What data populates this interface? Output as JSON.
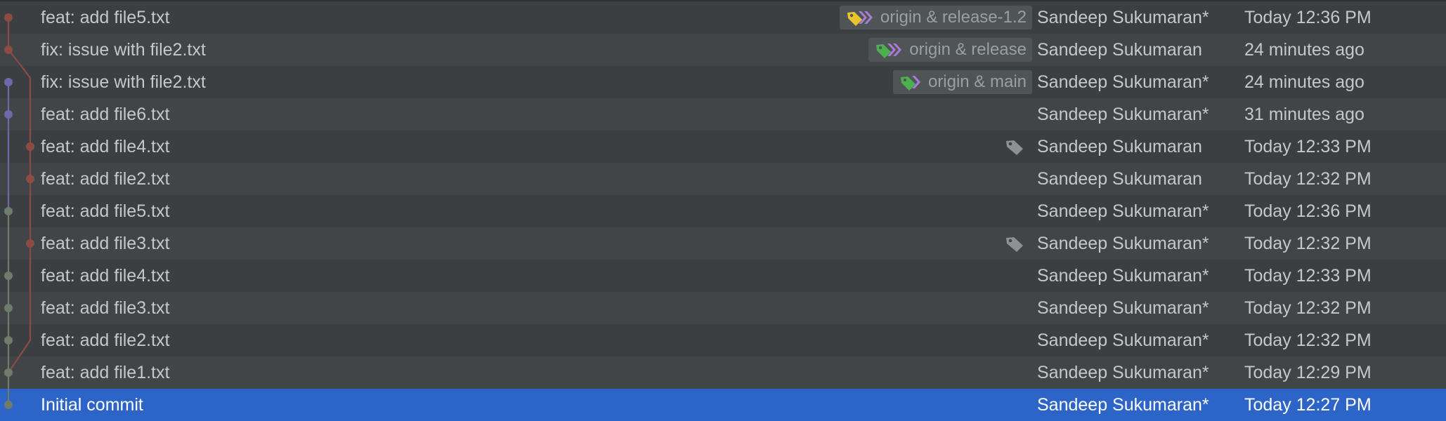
{
  "colors": {
    "background": "#3c3f41",
    "row_alt": "#414547",
    "selected": "#2d64c8",
    "branch_red": "#8c4c44",
    "branch_purple": "#6e67a8",
    "branch_green": "#6f7b6b",
    "tag_yellow": "#e6c530",
    "tag_green": "#4cb04e",
    "tag_purple": "#a97bd4"
  },
  "commits": [
    {
      "message": "feat: add file5.txt",
      "refs": "origin & release-1.2",
      "ref_icon": "yellow-tag-purple-branches-icon",
      "author": "Sandeep Sukumaran*",
      "date": "Today 12:36 PM"
    },
    {
      "message": "fix: issue with file2.txt",
      "refs": "origin & release",
      "ref_icon": "green-tag-purple-branches-icon",
      "author": "Sandeep Sukumaran",
      "date": "24 minutes ago"
    },
    {
      "message": "fix: issue with file2.txt",
      "refs": "origin & main",
      "ref_icon": "green-tag-purple-branch-icon",
      "author": "Sandeep Sukumaran*",
      "date": "24 minutes ago"
    },
    {
      "message": "feat: add file6.txt",
      "author": "Sandeep Sukumaran*",
      "date": "31 minutes ago"
    },
    {
      "message": "feat: add file4.txt",
      "tag_icon": "tag-icon",
      "author": "Sandeep Sukumaran",
      "date": "Today 12:33 PM"
    },
    {
      "message": "feat: add file2.txt",
      "author": "Sandeep Sukumaran",
      "date": "Today 12:32 PM"
    },
    {
      "message": "feat: add file5.txt",
      "author": "Sandeep Sukumaran*",
      "date": "Today 12:36 PM"
    },
    {
      "message": "feat: add file3.txt",
      "tag_icon": "tag-icon",
      "author": "Sandeep Sukumaran*",
      "date": "Today 12:32 PM"
    },
    {
      "message": "feat: add file4.txt",
      "author": "Sandeep Sukumaran*",
      "date": "Today 12:33 PM"
    },
    {
      "message": "feat: add file3.txt",
      "author": "Sandeep Sukumaran*",
      "date": "Today 12:32 PM"
    },
    {
      "message": "feat: add file2.txt",
      "author": "Sandeep Sukumaran*",
      "date": "Today 12:32 PM"
    },
    {
      "message": "feat: add file1.txt",
      "author": "Sandeep Sukumaran*",
      "date": "Today 12:29 PM"
    },
    {
      "message": "Initial commit",
      "author": "Sandeep Sukumaran*",
      "date": "Today 12:27 PM",
      "selected": true
    }
  ]
}
